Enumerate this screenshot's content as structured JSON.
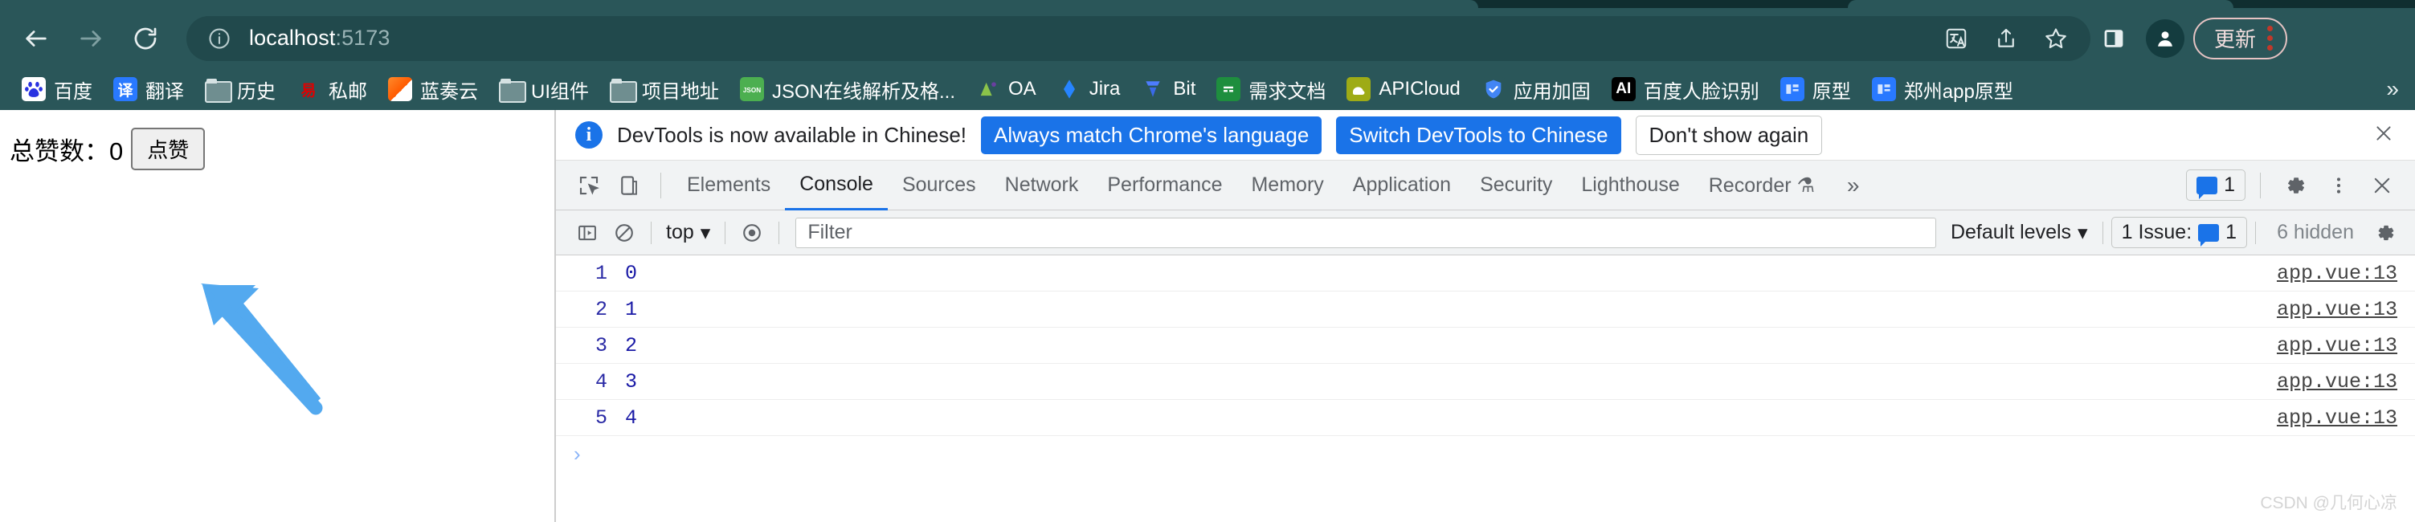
{
  "browser": {
    "nav": {
      "back_label": "Back",
      "forward_label": "Forward",
      "reload_label": "Reload"
    },
    "omnibox": {
      "host": "localhost",
      "port": ":5173",
      "info_icon": "info-circle-icon",
      "translate_icon": "translate-icon",
      "share_icon": "share-icon",
      "bookmark_icon": "star-icon"
    },
    "toolbar_right": {
      "sidepanel_icon": "side-panel-icon",
      "profile_icon": "profile-avatar-icon",
      "update_label": "更新",
      "menu_icon": "three-dot-menu-icon"
    },
    "bookmarks": [
      {
        "label": "百度",
        "icon": "baidu-paw-icon",
        "icon_bg": "#ffffff",
        "icon_fg": "#2932e1",
        "glyph": "熊"
      },
      {
        "label": "翻译",
        "icon": "translate-icon",
        "icon_bg": "#2979ff",
        "icon_fg": "#ffffff",
        "glyph": "译"
      },
      {
        "label": "历史",
        "icon": "folder-icon",
        "icon_bg": "",
        "icon_fg": "",
        "glyph": ""
      },
      {
        "label": "私邮",
        "icon": "netease-mail-icon",
        "icon_bg": "#2a5659",
        "icon_fg": "#e00000",
        "glyph": "易"
      },
      {
        "label": "蓝奏云",
        "icon": "lanzou-icon",
        "icon_bg": "#ff6a00",
        "icon_fg": "#ffffff",
        "glyph": ""
      },
      {
        "label": "UI组件",
        "icon": "folder-icon",
        "icon_bg": "",
        "icon_fg": "",
        "glyph": ""
      },
      {
        "label": "项目地址",
        "icon": "folder-icon",
        "icon_bg": "",
        "icon_fg": "",
        "glyph": ""
      },
      {
        "label": "JSON在线解析及格...",
        "icon": "json-icon",
        "icon_bg": "#4caf50",
        "icon_fg": "#ffffff",
        "glyph": "J"
      },
      {
        "label": "OA",
        "icon": "oa-icon",
        "icon_bg": "#2a5659",
        "icon_fg": "#8bc34a",
        "glyph": "A"
      },
      {
        "label": "Jira",
        "icon": "jira-icon",
        "icon_bg": "#2a5659",
        "icon_fg": "#2684ff",
        "glyph": "◆"
      },
      {
        "label": "Bit",
        "icon": "bit-icon",
        "icon_bg": "#2a5659",
        "icon_fg": "#4d7cfe",
        "glyph": ""
      },
      {
        "label": "需求文档",
        "icon": "sheets-icon",
        "icon_bg": "#1e8e3e",
        "icon_fg": "#ffffff",
        "glyph": ""
      },
      {
        "label": "APICloud",
        "icon": "apicloud-icon",
        "icon_bg": "#9eab16",
        "icon_fg": "#ffffff",
        "glyph": "◔"
      },
      {
        "label": "应用加固",
        "icon": "shield-icon",
        "icon_bg": "#2a5659",
        "icon_fg": "#4285f4",
        "glyph": ""
      },
      {
        "label": "百度人脸识别",
        "icon": "ai-icon",
        "icon_bg": "#000000",
        "icon_fg": "#ffffff",
        "glyph": "AI"
      },
      {
        "label": "原型",
        "icon": "axure-icon",
        "icon_bg": "#2979ff",
        "icon_fg": "#ffffff",
        "glyph": ""
      },
      {
        "label": "郑州app原型",
        "icon": "axure-icon",
        "icon_bg": "#2979ff",
        "icon_fg": "#ffffff",
        "glyph": ""
      }
    ],
    "bookmarks_overflow": "»"
  },
  "page": {
    "total_likes_label": "总赞数：",
    "total_likes_value": "0",
    "like_button_label": "点赞"
  },
  "devtools": {
    "banner": {
      "info_icon": "info-icon",
      "message": "DevTools is now available in Chinese!",
      "primary_button": "Always match Chrome's language",
      "secondary_button": "Switch DevTools to Chinese",
      "tertiary_button": "Don't show again",
      "close_icon": "close-icon"
    },
    "tabs": {
      "inspect_icon": "inspect-element-icon",
      "device_icon": "device-toolbar-icon",
      "items": [
        {
          "label": "Elements",
          "active": false
        },
        {
          "label": "Console",
          "active": true
        },
        {
          "label": "Sources",
          "active": false
        },
        {
          "label": "Network",
          "active": false
        },
        {
          "label": "Performance",
          "active": false
        },
        {
          "label": "Memory",
          "active": false
        },
        {
          "label": "Application",
          "active": false
        },
        {
          "label": "Security",
          "active": false
        },
        {
          "label": "Lighthouse",
          "active": false
        },
        {
          "label": "Recorder ⚗",
          "active": false
        }
      ],
      "more_label": "»",
      "issues_count": "1",
      "settings_icon": "gear-icon",
      "more_options_icon": "three-dot-menu-icon",
      "close_icon": "close-icon"
    },
    "filterbar": {
      "sidebar_icon": "console-sidebar-icon",
      "clear_icon": "clear-console-icon",
      "context_selector": "top",
      "context_caret": "▾",
      "eye_icon": "live-expression-icon",
      "filter_placeholder": "Filter",
      "levels_label": "Default levels",
      "levels_caret": "▾",
      "issues_label": "1 Issue:",
      "issues_count": "1",
      "hidden_label": "6 hidden",
      "settings_icon": "gear-icon"
    },
    "console_logs": [
      {
        "num": "1",
        "value": "0",
        "source": "app.vue:13"
      },
      {
        "num": "2",
        "value": "1",
        "source": "app.vue:13"
      },
      {
        "num": "3",
        "value": "2",
        "source": "app.vue:13"
      },
      {
        "num": "4",
        "value": "3",
        "source": "app.vue:13"
      },
      {
        "num": "5",
        "value": "4",
        "source": "app.vue:13"
      }
    ],
    "prompt_caret": "›"
  },
  "watermark": "CSDN @几何心凉",
  "colors": {
    "chrome_bg": "#2a5659",
    "chrome_dark": "#102e30",
    "omnibox_bg": "#21494c",
    "accent_blue": "#1a73e8",
    "annotation_arrow": "#53a9ef",
    "log_text": "#1a1aa6"
  }
}
